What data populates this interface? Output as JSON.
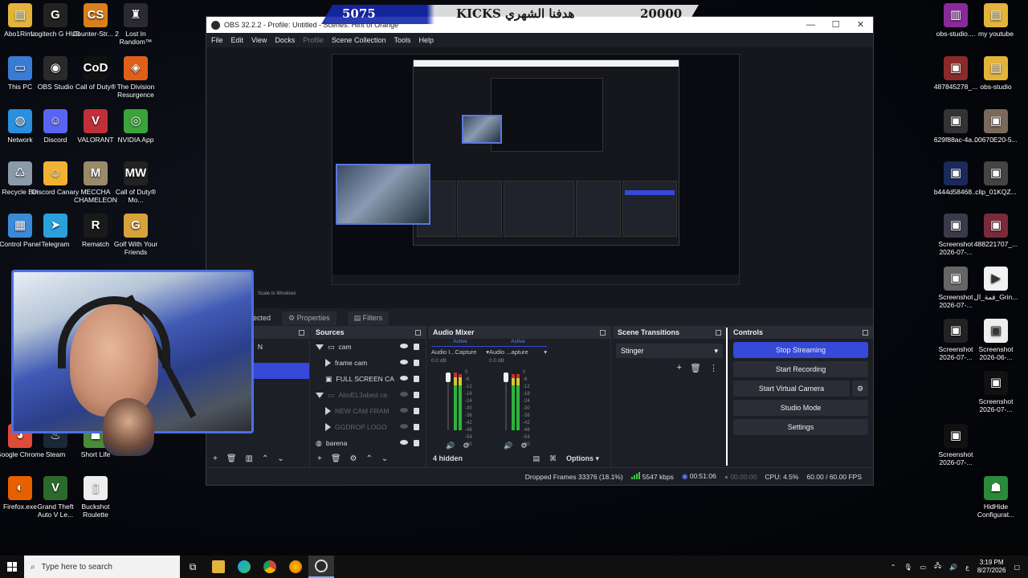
{
  "banner": {
    "left_num": "5075",
    "middle": "KICKS هدفنا الشهري",
    "right_num": "20000"
  },
  "desktop_left": [
    {
      "label": "Abo1Rima",
      "icon": "folder-icon",
      "color": "#e3b43b",
      "glyph": "▤"
    },
    {
      "label": "Logitech G HUB",
      "icon": "logitech-icon",
      "color": "#222",
      "glyph": "G"
    },
    {
      "label": "Counter-Str... 2",
      "icon": "cs2-icon",
      "color": "#d9801c",
      "glyph": "CS"
    },
    {
      "label": "Lost In Random™",
      "icon": "lost-in-random-icon",
      "color": "#2b2a33",
      "glyph": "♜"
    },
    {
      "label": "This PC",
      "icon": "computer-icon",
      "color": "#3a7bd5",
      "glyph": "▭"
    },
    {
      "label": "OBS Studio",
      "icon": "obs-icon",
      "color": "#2a2a2a",
      "glyph": "◉"
    },
    {
      "label": "Call of Duty®",
      "icon": "cod-icon",
      "color": "#111",
      "glyph": "CoD"
    },
    {
      "label": "The Division Resurgence",
      "icon": "division-icon",
      "color": "#e0601a",
      "glyph": "◈"
    },
    {
      "label": "Network",
      "icon": "network-icon",
      "color": "#2a8fdc",
      "glyph": "◍"
    },
    {
      "label": "Discord",
      "icon": "discord-icon",
      "color": "#5865f2",
      "glyph": "☺"
    },
    {
      "label": "VALORANT",
      "icon": "valorant-icon",
      "color": "#c0303a",
      "glyph": "V"
    },
    {
      "label": "NVIDIA App",
      "icon": "nvidia-icon",
      "color": "#3aa33a",
      "glyph": "◎"
    },
    {
      "label": "Recycle Bin",
      "icon": "recycle-bin-icon",
      "color": "#8a9aa8",
      "glyph": "♺"
    },
    {
      "label": "Discord Canary",
      "icon": "discord-canary-icon",
      "color": "#f0b232",
      "glyph": "☺"
    },
    {
      "label": "MECCHA CHAMELEON",
      "icon": "meccha-icon",
      "color": "#9a8a6a",
      "glyph": "M"
    },
    {
      "label": "Call of Duty® Mo...",
      "icon": "cod-mobile-icon",
      "color": "#222",
      "glyph": "MW"
    },
    {
      "label": "Control Panel",
      "icon": "control-panel-icon",
      "color": "#3a8ad8",
      "glyph": "▦"
    },
    {
      "label": "Telegram",
      "icon": "telegram-icon",
      "color": "#2aa1db",
      "glyph": "➤"
    },
    {
      "label": "Rematch",
      "icon": "rematch-icon",
      "color": "#1a1a1a",
      "glyph": "R"
    },
    {
      "label": "Golf With Your Friends",
      "icon": "golf-icon",
      "color": "#d8a23a",
      "glyph": "G"
    },
    {
      "label": "Google Chrome",
      "icon": "chrome-icon",
      "color": "#dd4b39",
      "glyph": "◕"
    },
    {
      "label": "Steam",
      "icon": "steam-icon",
      "color": "#1b2838",
      "glyph": "♨"
    },
    {
      "label": "Short Life",
      "icon": "short-life-icon",
      "color": "#4a8a3a",
      "glyph": "☗"
    },
    {
      "label": "Firefox.exe",
      "icon": "firefox-icon",
      "color": "#e66000",
      "glyph": "◐"
    },
    {
      "label": "Grand Theft Auto V Le...",
      "icon": "gta-icon",
      "color": "#2c6a2c",
      "glyph": "V"
    },
    {
      "label": "Buckshot Roulette",
      "icon": "buckshot-icon",
      "color": "#eeeeee",
      "glyph": "▯"
    }
  ],
  "desktop_right": [
    {
      "label": "obs-studio....",
      "icon": "winrar-icon",
      "color": "#8a2a9a",
      "glyph": "▥"
    },
    {
      "label": "my youtube",
      "icon": "folder-icon",
      "color": "#e3b43b",
      "glyph": "▤"
    },
    {
      "label": "487845278_...",
      "icon": "image-icon",
      "color": "#8a2a2a",
      "glyph": "▣"
    },
    {
      "label": "obs-studio",
      "icon": "folder-icon",
      "color": "#e3b43b",
      "glyph": "▤"
    },
    {
      "label": "629f88ac-4a...",
      "icon": "image-icon",
      "color": "#333",
      "glyph": "▣"
    },
    {
      "label": "00670E20-5...",
      "icon": "image-icon",
      "color": "#7a6a5a",
      "glyph": "▣"
    },
    {
      "label": "b444d58468...",
      "icon": "image-icon",
      "color": "#1a2a5a",
      "glyph": "▣"
    },
    {
      "label": "clip_01KQZ...",
      "icon": "image-icon",
      "color": "#444",
      "glyph": "▣"
    },
    {
      "label": "Screenshot 2026-07-...",
      "icon": "image-icon",
      "color": "#3a3a4a",
      "glyph": "▣"
    },
    {
      "label": "488221707_...",
      "icon": "image-icon",
      "color": "#7a2a3a",
      "glyph": "▣"
    },
    {
      "label": "Screenshot 2026-07-...",
      "icon": "image-icon",
      "color": "#666",
      "glyph": "▣"
    },
    {
      "label": "قمة_ال_Grin...",
      "icon": "video-icon",
      "color": "#f2f2f2",
      "glyph": "▶"
    },
    {
      "label": "Screenshot 2026-07-...",
      "icon": "image-icon",
      "color": "#222",
      "glyph": "▣"
    },
    {
      "label": "Screenshot 2026-06-...",
      "icon": "image-icon",
      "color": "#eee",
      "glyph": "▣"
    },
    {
      "label": "Screenshot 2026-07-...",
      "icon": "image-icon",
      "color": "#111",
      "glyph": "▣"
    },
    {
      "label": "Screenshot 2026-07-...",
      "icon": "image-icon",
      "color": "#111",
      "glyph": "▣"
    },
    {
      "label": "HidHide Configurat...",
      "icon": "hidhide-icon",
      "color": "#2a8a3a",
      "glyph": "☗"
    }
  ],
  "obs": {
    "title": "OBS 32.2.2 - Profile: Untitled - Scenes: Hint of Orange",
    "menu": [
      {
        "label": "File",
        "dim": false
      },
      {
        "label": "Edit",
        "dim": false
      },
      {
        "label": "View",
        "dim": false
      },
      {
        "label": "Docks",
        "dim": false
      },
      {
        "label": "Profile",
        "dim": true
      },
      {
        "label": "Scene Collection",
        "dim": false
      },
      {
        "label": "Tools",
        "dim": false
      },
      {
        "label": "Help",
        "dim": false
      }
    ],
    "scale_label": "Scale to Windows",
    "selected_label": "ected",
    "properties_btn": "Properties",
    "filters_btn": "Filters",
    "scenes_partial": "N",
    "sources_title": "Sources",
    "sources": [
      {
        "name": "cam",
        "type": "group-open",
        "dim": false,
        "visible": true
      },
      {
        "name": "frame cam",
        "type": "play",
        "dim": false,
        "visible": true
      },
      {
        "name": "FULL SCREEN CA",
        "type": "camera",
        "dim": false,
        "visible": true
      },
      {
        "name": "AboEL3abed ca",
        "type": "group-open",
        "dim": true,
        "visible": false
      },
      {
        "name": "NEW CAM FRAM",
        "type": "play",
        "dim": true,
        "visible": false
      },
      {
        "name": "GGDROP LOGO",
        "type": "play",
        "dim": true,
        "visible": false
      },
      {
        "name": "barena",
        "type": "globe",
        "dim": false,
        "visible": true
      }
    ],
    "mixer_title": "Audio Mixer",
    "channels": [
      {
        "active": "Active",
        "name": "Audio I...Capture",
        "db": "0.0 dB"
      },
      {
        "active": "Active",
        "name": "Audio ...apture",
        "db": "0.0 dB"
      }
    ],
    "meter_scale": [
      "0",
      "-6",
      "-12",
      "-18",
      "-24",
      "-30",
      "-36",
      "-42",
      "-48",
      "-54",
      "-60"
    ],
    "hidden_label": "4 hidden",
    "options_label": "Options",
    "transitions_title": "Scene Transitions",
    "transition_value": "Stinger",
    "controls_title": "Controls",
    "controls": {
      "stop_streaming": "Stop Streaming",
      "start_recording": "Start Recording",
      "start_virtual_camera": "Start Virtual Camera",
      "studio_mode": "Studio Mode",
      "settings": "Settings"
    },
    "status": {
      "dropped_frames": "Dropped Frames 33376 (18.1%)",
      "bitrate": "5547 kbps",
      "stream_time": "00:51:06",
      "rec_time": "00:00:00",
      "cpu": "CPU: 4.5%",
      "fps": "60.00 / 60.00 FPS"
    }
  },
  "taskbar": {
    "search_placeholder": "Type here to search",
    "time": "3:19 PM",
    "date": "8/27/2026",
    "lang": "ع"
  },
  "colors": {
    "accent": "#3649d8",
    "meter_green": "#2bb43a",
    "obs_bg": "#1d1f26"
  }
}
